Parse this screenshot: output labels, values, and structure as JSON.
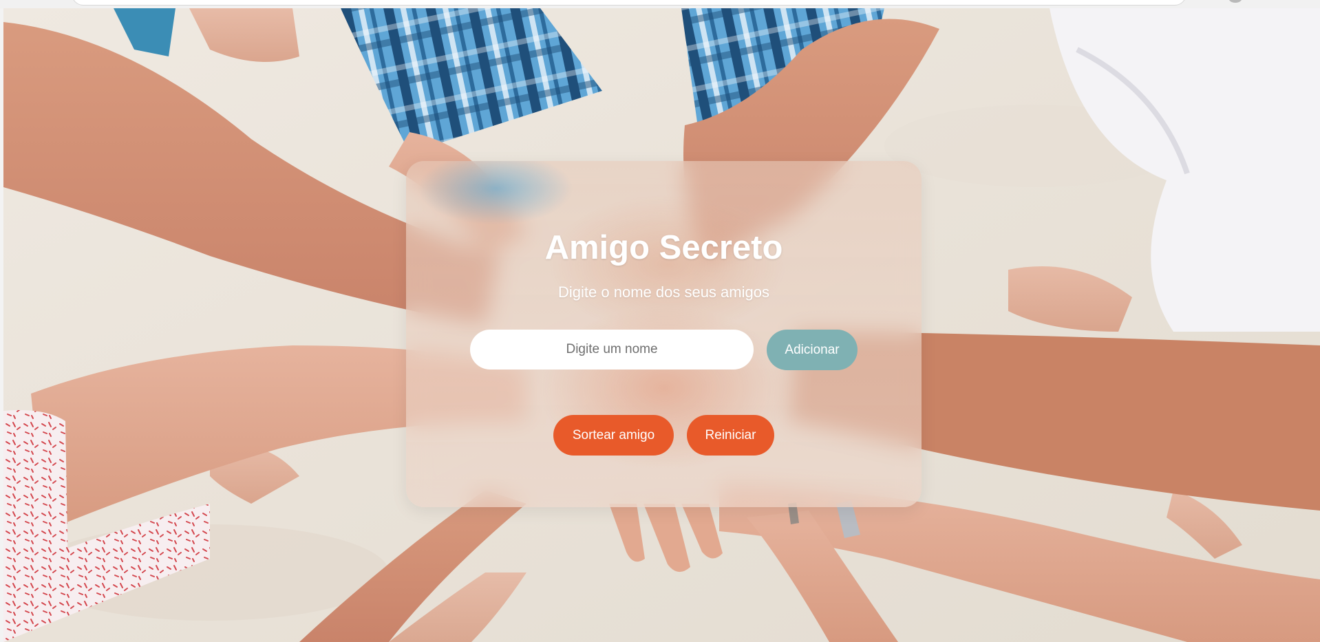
{
  "browser": {},
  "page": {
    "title": "Amigo Secreto",
    "subtitle": "Digite o nome dos seus amigos"
  },
  "form": {
    "name_input": {
      "placeholder": "Digite um nome",
      "value": ""
    },
    "add_button_label": "Adicionar"
  },
  "actions": {
    "draw_button_label": "Sortear amigo",
    "reset_button_label": "Reiniciar"
  },
  "colors": {
    "accent_orange": "#e85a2a",
    "add_button_teal": "#7fb1b3",
    "card_glass": "rgba(255,255,255,0.22)",
    "text_white": "#ffffff"
  },
  "background": {
    "description_icon": "hands-together-photo"
  }
}
